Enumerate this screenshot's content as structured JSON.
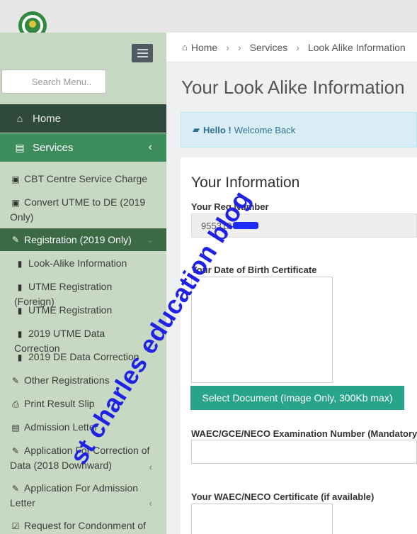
{
  "sidebar": {
    "search_placeholder": "Search Menu..",
    "home_label": "Home",
    "services_label": "Services",
    "items": [
      {
        "label": "CBT Centre Service Charge",
        "icon": "money-icon"
      },
      {
        "label": "Convert UTME to DE (2019 Only)",
        "icon": "money-icon"
      }
    ],
    "registration_label": "Registration (2019 Only)",
    "registration_items": [
      {
        "label": "Look-Alike Information",
        "icon": "book-icon"
      },
      {
        "label": "UTME Registration (Foreign)",
        "icon": "book-icon"
      },
      {
        "label": "UTME Registration",
        "icon": "book-icon"
      },
      {
        "label": "2019 UTME Data Correction",
        "icon": "book-icon"
      },
      {
        "label": "2019 DE Data Correction",
        "icon": "book-icon"
      }
    ],
    "more_items": [
      {
        "label": "Other Registrations",
        "icon": "edit-icon"
      },
      {
        "label": "Print Result Slip",
        "icon": "print-icon"
      },
      {
        "label": "Admission Letter",
        "icon": "document-icon"
      },
      {
        "label": "Application For Correction of Data (2018 Downward)",
        "icon": "pencil-icon"
      },
      {
        "label": "Application For Admission Letter",
        "icon": "pencil-icon"
      },
      {
        "label": "Request for Condonment of",
        "icon": "check-icon"
      }
    ]
  },
  "breadcrumb": {
    "home": "Home",
    "services": "Services",
    "current": "Look Alike Information"
  },
  "page_title": "Your Look Alike Information",
  "alert": {
    "bold": "Hello !",
    "text": "Welcome Back"
  },
  "form": {
    "section_title": "Your Information",
    "reg_label": "Your Reg Number",
    "reg_value": "955318",
    "dob_label": "Your Date of Birth Certificate",
    "upload_button": "Select Document (Image Only, 300Kb max)",
    "exam_label": "WAEC/GCE/NECO Examination Number (Mandatory)",
    "cert_label": "Your WAEC/NECO Certificate (if available)"
  },
  "watermark": "st charles education blog",
  "colors": {
    "sidebar_bg": "#c8d9c3",
    "home_bg": "#2f4a3c",
    "services_bg": "#3d8d5c",
    "registration_bg": "#3b6a45",
    "button_bg": "#27a48b",
    "alert_bg": "#d9edf7",
    "watermark": "#1f22e6"
  }
}
